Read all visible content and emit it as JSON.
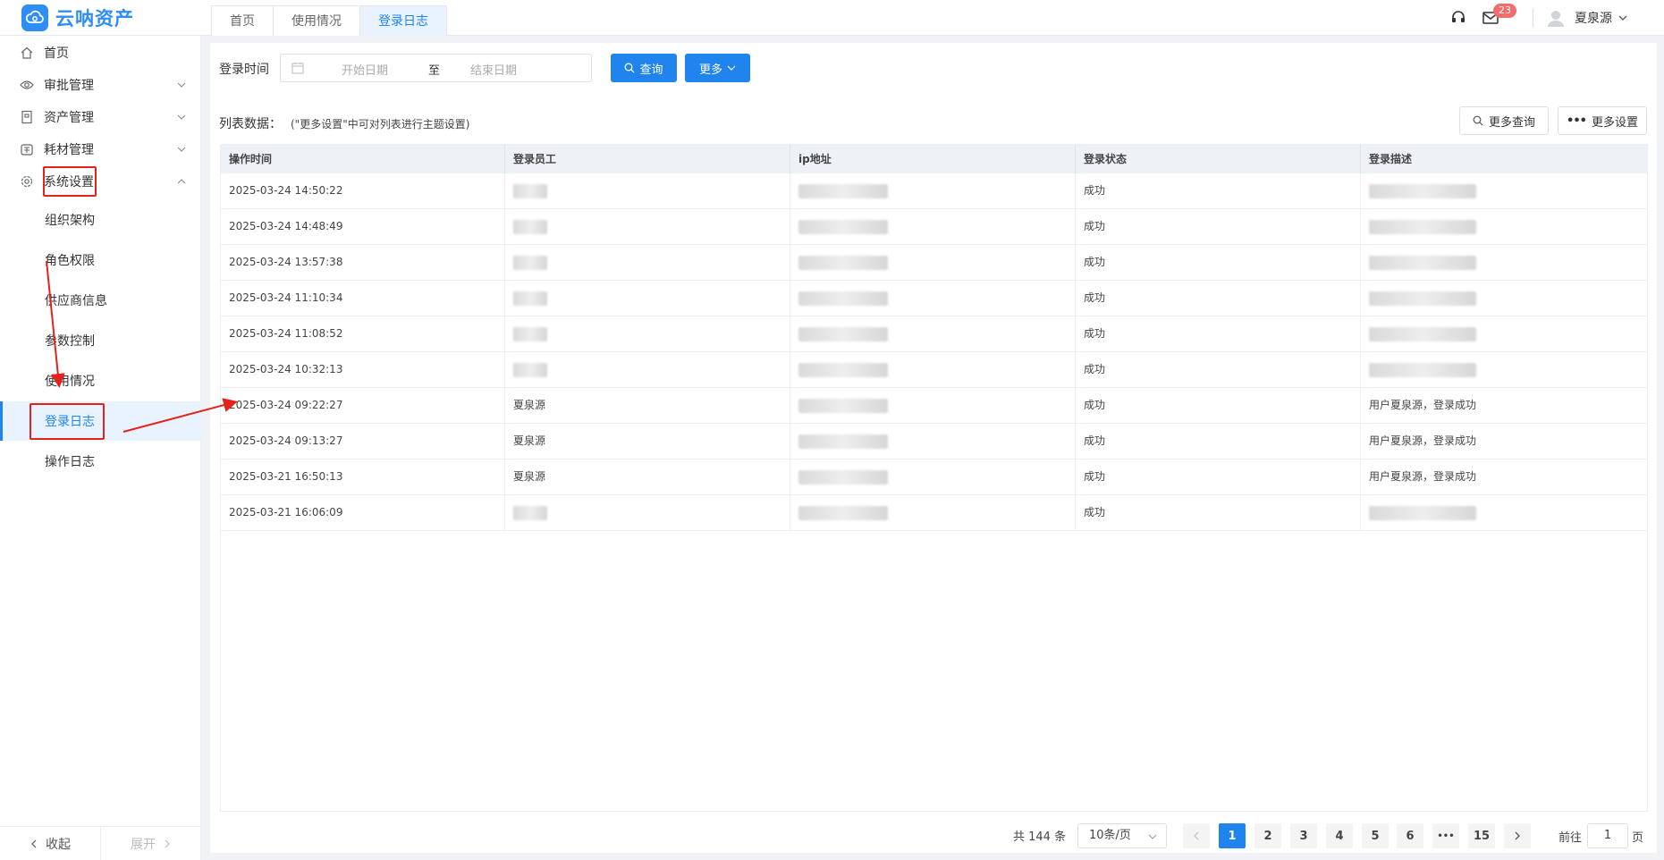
{
  "app": {
    "name": "云呐资产"
  },
  "tabs": [
    {
      "label": "首页",
      "active": false
    },
    {
      "label": "使用情况",
      "active": false
    },
    {
      "label": "登录日志",
      "active": true
    }
  ],
  "header": {
    "notification_count": "23",
    "user_name": "夏泉源"
  },
  "sidebar": {
    "menu": [
      {
        "label": "首页",
        "icon": "home-icon"
      },
      {
        "label": "审批管理",
        "icon": "eye-icon"
      },
      {
        "label": "资产管理",
        "icon": "asset-icon"
      },
      {
        "label": "耗材管理",
        "icon": "supplies-icon"
      },
      {
        "label": "系统设置",
        "icon": "gear-icon"
      }
    ],
    "sub_items": [
      {
        "label": "组织架构"
      },
      {
        "label": "角色权限"
      },
      {
        "label": "供应商信息"
      },
      {
        "label": "参数控制"
      },
      {
        "label": "使用情况"
      },
      {
        "label": "登录日志",
        "active": true
      },
      {
        "label": "操作日志"
      }
    ],
    "collapse_label": "收起",
    "expand_label": "展开"
  },
  "filter": {
    "label": "登录时间",
    "start_placeholder": "开始日期",
    "separator": "至",
    "end_placeholder": "结束日期",
    "query_button": "查询",
    "more_button": "更多"
  },
  "list": {
    "title": "列表数据：",
    "hint": "(\"更多设置\"中可对列表进行主题设置)",
    "more_query_button": "更多查询",
    "more_settings_button": "更多设置"
  },
  "table": {
    "columns": [
      "操作时间",
      "登录员工",
      "ip地址",
      "登录状态",
      "登录描述"
    ],
    "rows": [
      {
        "time": "2025-03-24 14:50:22",
        "employee": "",
        "ip": "",
        "status": "成功",
        "desc": ""
      },
      {
        "time": "2025-03-24 14:48:49",
        "employee": "",
        "ip": "",
        "status": "成功",
        "desc": ""
      },
      {
        "time": "2025-03-24 13:57:38",
        "employee": "",
        "ip": "",
        "status": "成功",
        "desc": ""
      },
      {
        "time": "2025-03-24 11:10:34",
        "employee": "",
        "ip": "",
        "status": "成功",
        "desc": ""
      },
      {
        "time": "2025-03-24 11:08:52",
        "employee": "",
        "ip": "",
        "status": "成功",
        "desc": ""
      },
      {
        "time": "2025-03-24 10:32:13",
        "employee": "",
        "ip": "",
        "status": "成功",
        "desc": ""
      },
      {
        "time": "2025-03-24 09:22:27",
        "employee": "夏泉源",
        "ip": "",
        "status": "成功",
        "desc": "用户夏泉源，登录成功"
      },
      {
        "time": "2025-03-24 09:13:27",
        "employee": "夏泉源",
        "ip": "",
        "status": "成功",
        "desc": "用户夏泉源，登录成功"
      },
      {
        "time": "2025-03-21 16:50:13",
        "employee": "夏泉源",
        "ip": "",
        "status": "成功",
        "desc": "用户夏泉源，登录成功"
      },
      {
        "time": "2025-03-21 16:06:09",
        "employee": "",
        "ip": "",
        "status": "成功",
        "desc": ""
      }
    ]
  },
  "pagination": {
    "total": "共 144 条",
    "page_size": "10条/页",
    "pages": [
      "1",
      "2",
      "3",
      "4",
      "5",
      "6",
      "•••",
      "15"
    ],
    "current": "1",
    "goto_label": "前往",
    "goto_value": "1",
    "unit": "页"
  },
  "colors": {
    "primary": "#1f84ee",
    "annotation": "#e8201a",
    "badge": "#f56c6c"
  }
}
